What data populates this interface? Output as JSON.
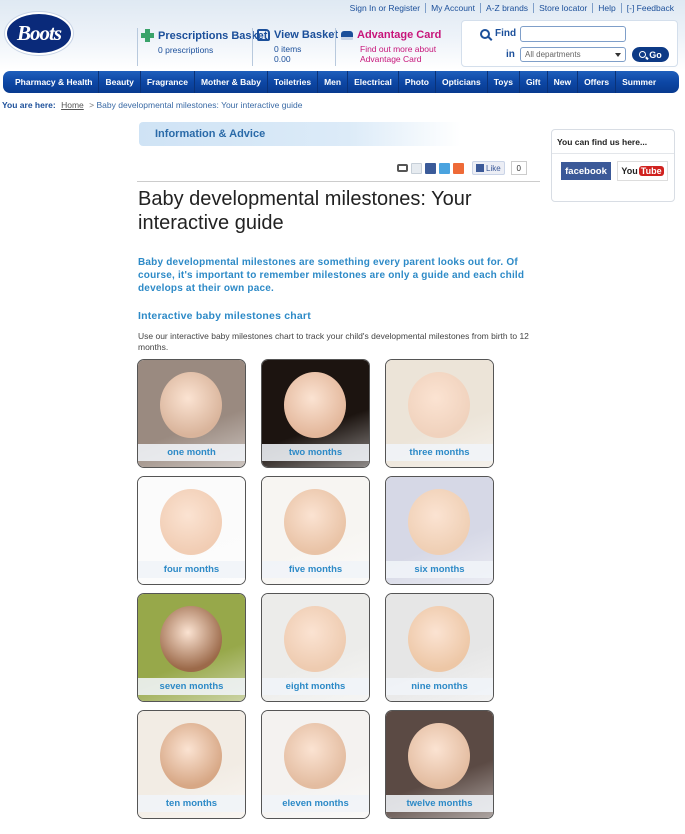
{
  "header": {
    "logo_text": "Boots",
    "top_links": [
      "Sign In or Register",
      "My Account",
      "A-Z brands",
      "Store locator",
      "Help",
      "[-] Feedback"
    ],
    "prescriptions": {
      "title": "Prescriptions Basket",
      "count": "0 prescriptions"
    },
    "basket": {
      "title": "View Basket",
      "items": "0 items",
      "total": "0.00"
    },
    "advantage": {
      "title": "Advantage Card",
      "line1": "Find out more about",
      "line2": "Advantage Card"
    },
    "search": {
      "find_label": "Find",
      "find_value": "",
      "in_label": "in",
      "department": "All departments",
      "go_label": "Go"
    }
  },
  "nav": {
    "items": [
      "Pharmacy & Health",
      "Beauty",
      "Fragrance",
      "Mother & Baby",
      "Toiletries",
      "Men",
      "Electrical",
      "Photo",
      "Opticians",
      "Toys",
      "Gift",
      "New",
      "Offers",
      "Summer"
    ]
  },
  "breadcrumb": {
    "prefix": "You are here:",
    "home": "Home",
    "separator": ">",
    "current": "Baby developmental milestones: Your interactive guide"
  },
  "section": {
    "title": "Information & Advice"
  },
  "share": {
    "icons": [
      "print-icon",
      "email-icon",
      "facebook-icon",
      "twitter-icon",
      "addthis-icon"
    ],
    "like_label": "Like",
    "like_count": "0"
  },
  "article": {
    "title": "Baby developmental milestones: Your interactive guide",
    "intro": "Baby developmental milestones are something every parent looks out for. Of course, it's important to remember milestones are only a guide and each child develops at their own pace.",
    "subheading": "Interactive baby milestones chart",
    "description": "Use our interactive baby milestones chart to track your child's developmental milestones from birth to 12 months."
  },
  "milestones": [
    {
      "label": "one month",
      "bg": "#9a8a80",
      "skin": "#d9b49b"
    },
    {
      "label": "two months",
      "bg": "#1c1410",
      "skin": "#e3b79b"
    },
    {
      "label": "three months",
      "bg": "#ece4d8",
      "skin": "#f0d2bd"
    },
    {
      "label": "four months",
      "bg": "#fbfbfb",
      "skin": "#f1cdb4"
    },
    {
      "label": "five months",
      "bg": "#f7f5f2",
      "skin": "#e9c3a6"
    },
    {
      "label": "six months",
      "bg": "#d6d8e6",
      "skin": "#efcfb4"
    },
    {
      "label": "seven months",
      "bg": "#97a84a",
      "skin": "#9c6a4a"
    },
    {
      "label": "eight months",
      "bg": "#ececea",
      "skin": "#eecbb0"
    },
    {
      "label": "nine months",
      "bg": "#e6e6e6",
      "skin": "#edc7a6"
    },
    {
      "label": "ten months",
      "bg": "#f2ece4",
      "skin": "#d7a785"
    },
    {
      "label": "eleven months",
      "bg": "#f4f2f0",
      "skin": "#e3bca0"
    },
    {
      "label": "twelve months",
      "bg": "#5b4a44",
      "skin": "#e3bca0"
    }
  ],
  "sidebar": {
    "heading": "You can find us here...",
    "facebook": "facebook",
    "youtube_you": "You",
    "youtube_tube": "Tube"
  }
}
